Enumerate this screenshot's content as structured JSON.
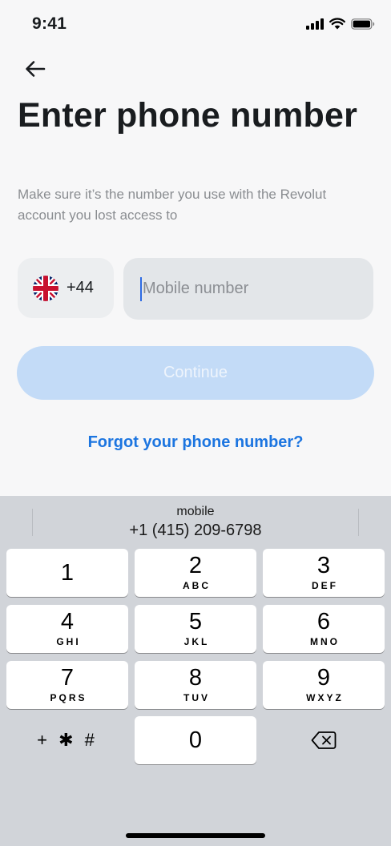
{
  "status_bar": {
    "time": "9:41"
  },
  "header": {
    "title": "Enter phone number",
    "subtitle": "Make sure it’s the number you use with the Revolut account you lost access to"
  },
  "phone_form": {
    "country_code": "+44",
    "country_flag": "united-kingdom-flag",
    "phone_placeholder": "Mobile number",
    "phone_value": ""
  },
  "actions": {
    "continue_label": "Continue",
    "forgot_label": "Forgot your phone number?"
  },
  "keyboard": {
    "suggestion": {
      "label": "mobile",
      "number": "+1 (415) 209-6798"
    },
    "keys": [
      {
        "digit": "1",
        "letters": ""
      },
      {
        "digit": "2",
        "letters": "ABC"
      },
      {
        "digit": "3",
        "letters": "DEF"
      },
      {
        "digit": "4",
        "letters": "GHI"
      },
      {
        "digit": "5",
        "letters": "JKL"
      },
      {
        "digit": "6",
        "letters": "MNO"
      },
      {
        "digit": "7",
        "letters": "PQRS"
      },
      {
        "digit": "8",
        "letters": "TUV"
      },
      {
        "digit": "9",
        "letters": "WXYZ"
      },
      {
        "digit": "0",
        "letters": ""
      }
    ],
    "symbols_label": "+ ✱ #",
    "delete_icon": "delete-backspace-icon"
  },
  "colors": {
    "accent": "#1c75e0",
    "continue_disabled_bg": "#c3dbf7",
    "input_bg": "#e3e6e9",
    "keyboard_bg": "#d1d4d9"
  }
}
